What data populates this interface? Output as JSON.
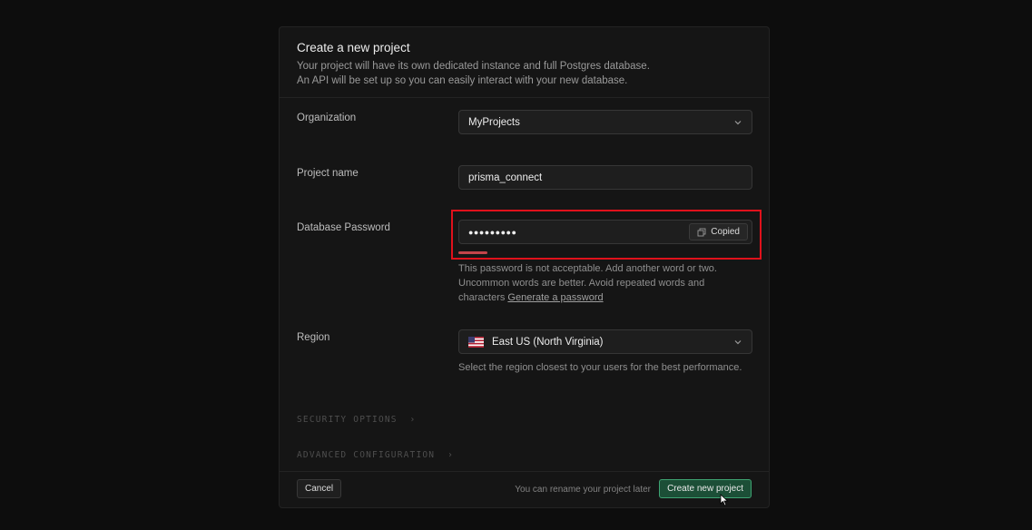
{
  "header": {
    "title": "Create a new project",
    "desc_line1": "Your project will have its own dedicated instance and full Postgres database.",
    "desc_line2": "An API will be set up so you can easily interact with your new database."
  },
  "organization": {
    "label": "Organization",
    "value": "MyProjects",
    "icon": "chevron-down-icon"
  },
  "project_name": {
    "label": "Project name",
    "value": "prisma_connect"
  },
  "password": {
    "label": "Database Password",
    "value": "●●●●●●●●●",
    "copy_label": "Copied",
    "strength_fraction": 0.1,
    "help_text": "This password is not acceptable. Add another word or two. Uncommon words are better. Avoid repeated words and characters",
    "generate_link": "Generate a password"
  },
  "region": {
    "label": "Region",
    "value": "East US (North Virginia)",
    "help_text": "Select the region closest to your users for the best performance.",
    "icon": "us-flag-icon"
  },
  "sections": {
    "security": "SECURITY OPTIONS",
    "advanced": "ADVANCED CONFIGURATION"
  },
  "footer": {
    "cancel": "Cancel",
    "rename_note": "You can rename your project later",
    "create": "Create new project"
  },
  "colors": {
    "accent": "#3ea372",
    "highlight": "#e0111b",
    "strength_weak": "#c4454a"
  }
}
